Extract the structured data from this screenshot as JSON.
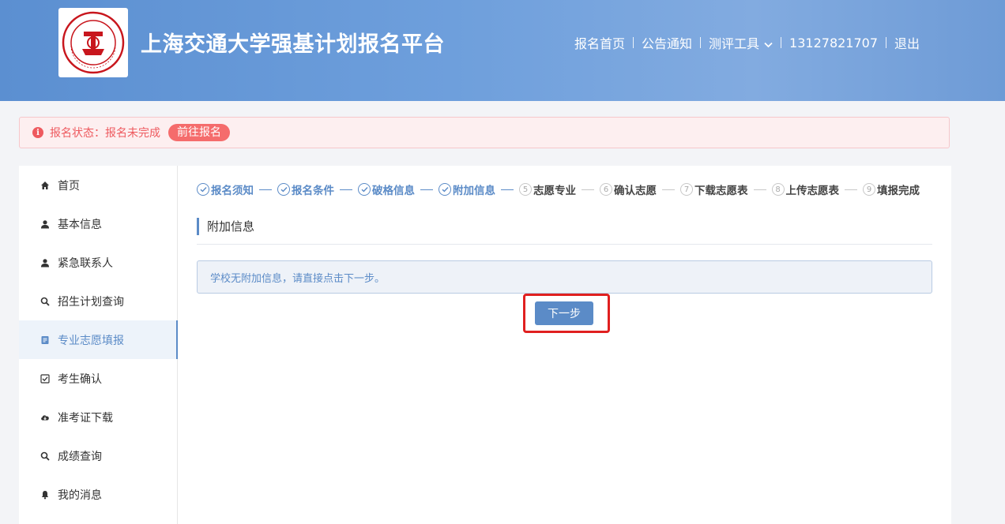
{
  "header": {
    "title": "上海交通大学强基计划报名平台",
    "logo_icon": "sjtu-seal-logo",
    "nav": {
      "home": "报名首页",
      "notice": "公告通知",
      "tools": "测评工具",
      "phone": "13127821707",
      "logout": "退出"
    }
  },
  "alert": {
    "text": "报名状态：报名未完成",
    "button": "前往报名",
    "color": "#ee5a5f"
  },
  "sidebar": {
    "items": [
      {
        "label": "首页",
        "icon": "home-icon"
      },
      {
        "label": "基本信息",
        "icon": "user-icon"
      },
      {
        "label": "紧急联系人",
        "icon": "user-icon"
      },
      {
        "label": "招生计划查询",
        "icon": "search-icon"
      },
      {
        "label": "专业志愿填报",
        "icon": "document-icon",
        "active": true
      },
      {
        "label": "考生确认",
        "icon": "checkbox-icon"
      },
      {
        "label": "准考证下载",
        "icon": "cloud-download-icon"
      },
      {
        "label": "成绩查询",
        "icon": "search-icon"
      },
      {
        "label": "我的消息",
        "icon": "bell-icon"
      }
    ]
  },
  "steps": [
    {
      "num": "1",
      "label": "报名须知",
      "done": true
    },
    {
      "num": "2",
      "label": "报名条件",
      "done": true
    },
    {
      "num": "3",
      "label": "破格信息",
      "done": true
    },
    {
      "num": "4",
      "label": "附加信息",
      "done": true
    },
    {
      "num": "5",
      "label": "志愿专业",
      "done": false
    },
    {
      "num": "6",
      "label": "确认志愿",
      "done": false
    },
    {
      "num": "7",
      "label": "下载志愿表",
      "done": false
    },
    {
      "num": "8",
      "label": "上传志愿表",
      "done": false
    },
    {
      "num": "9",
      "label": "填报完成",
      "done": false
    }
  ],
  "main": {
    "section_title": "附加信息",
    "info": "学校无附加信息，请直接点击下一步。",
    "next_button": "下一步"
  },
  "colors": {
    "accent": "#5b8bc7",
    "header_gradient": "#6e9fdc",
    "highlight": "#e02020"
  }
}
